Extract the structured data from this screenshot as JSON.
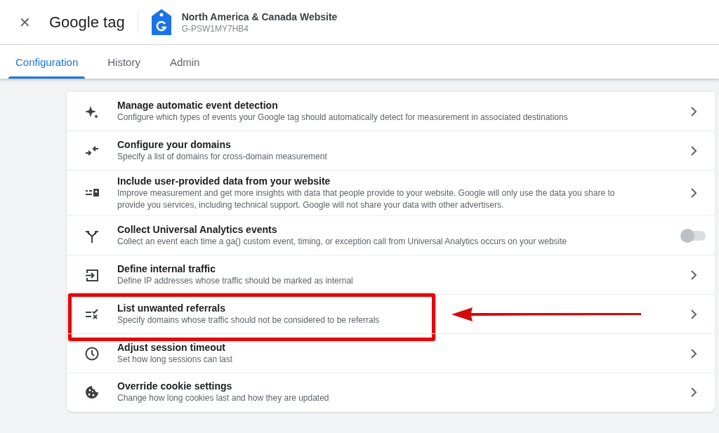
{
  "header": {
    "close": "✕",
    "title": "Google tag",
    "tag_name": "North America & Canada Website",
    "tag_id": "G-PSW1MY7HB4"
  },
  "tabs": [
    {
      "label": "Configuration",
      "selected": true
    },
    {
      "label": "History",
      "selected": false
    },
    {
      "label": "Admin",
      "selected": false
    }
  ],
  "settings": [
    {
      "title": "Manage automatic event detection",
      "description": "Configure which types of events your Google tag should automatically detect for measurement in associated destinations",
      "kind": "link",
      "highlighted": false
    },
    {
      "title": "Configure your domains",
      "description": "Specify a list of domains for cross-domain measurement",
      "kind": "link",
      "highlighted": false
    },
    {
      "title": "Include user-provided data from your website",
      "description": "Improve measurement and get more insights with data that people provide to your website. Google will only use the data you share to provide you services, including technical support. Google will not share your data with other advertisers.",
      "kind": "link",
      "highlighted": false
    },
    {
      "title": "Collect Universal Analytics events",
      "description": "Collect an event each time a ga() custom event, timing, or exception call from Universal Analytics occurs on your website",
      "kind": "toggle",
      "on": false,
      "highlighted": false
    },
    {
      "title": "Define internal traffic",
      "description": "Define IP addresses whose traffic should be marked as internal",
      "kind": "link",
      "highlighted": false
    },
    {
      "title": "List unwanted referrals",
      "description": "Specify domains whose traffic should not be considered to be referrals",
      "kind": "link",
      "highlighted": true
    },
    {
      "title": "Adjust session timeout",
      "description": "Set how long sessions can last",
      "kind": "link",
      "highlighted": false
    },
    {
      "title": "Override cookie settings",
      "description": "Change how long cookies last and how they are updated",
      "kind": "link",
      "highlighted": false
    }
  ]
}
